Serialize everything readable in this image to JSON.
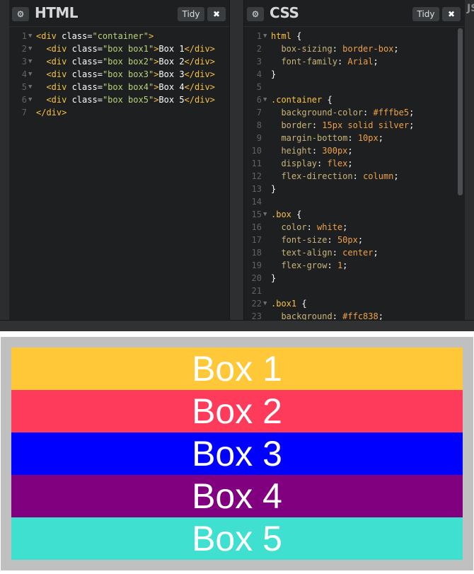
{
  "editor": {
    "html_panel": {
      "title": "HTML",
      "tidy_label": "Tidy",
      "close_label": "✖",
      "settings_icon": "gear-icon",
      "lines": [
        {
          "n": "1",
          "fold": true,
          "parts": [
            [
              "t-tag",
              "<div "
            ],
            [
              "t-attr",
              "class="
            ],
            [
              "t-str",
              "\"container\""
            ],
            [
              "t-tag",
              ">"
            ]
          ]
        },
        {
          "n": "2",
          "fold": true,
          "parts": [
            [
              "t-pun",
              "  "
            ],
            [
              "t-tag",
              "<div "
            ],
            [
              "t-attr",
              "class="
            ],
            [
              "t-str",
              "\"box box1\""
            ],
            [
              "t-tag",
              ">"
            ],
            [
              "t-txt",
              "Box 1"
            ],
            [
              "t-tag",
              "</div>"
            ]
          ]
        },
        {
          "n": "3",
          "fold": true,
          "parts": [
            [
              "t-pun",
              "  "
            ],
            [
              "t-tag",
              "<div "
            ],
            [
              "t-attr",
              "class="
            ],
            [
              "t-str",
              "\"box box2\""
            ],
            [
              "t-tag",
              ">"
            ],
            [
              "t-txt",
              "Box 2"
            ],
            [
              "t-tag",
              "</div>"
            ]
          ]
        },
        {
          "n": "4",
          "fold": true,
          "parts": [
            [
              "t-pun",
              "  "
            ],
            [
              "t-tag",
              "<div "
            ],
            [
              "t-attr",
              "class="
            ],
            [
              "t-str",
              "\"box box3\""
            ],
            [
              "t-tag",
              ">"
            ],
            [
              "t-txt",
              "Box 3"
            ],
            [
              "t-tag",
              "</div>"
            ]
          ]
        },
        {
          "n": "5",
          "fold": true,
          "parts": [
            [
              "t-pun",
              "  "
            ],
            [
              "t-tag",
              "<div "
            ],
            [
              "t-attr",
              "class="
            ],
            [
              "t-str",
              "\"box box4\""
            ],
            [
              "t-tag",
              ">"
            ],
            [
              "t-txt",
              "Box 4"
            ],
            [
              "t-tag",
              "</div>"
            ]
          ]
        },
        {
          "n": "6",
          "fold": true,
          "parts": [
            [
              "t-pun",
              "  "
            ],
            [
              "t-tag",
              "<div "
            ],
            [
              "t-attr",
              "class="
            ],
            [
              "t-str",
              "\"box box5\""
            ],
            [
              "t-tag",
              ">"
            ],
            [
              "t-txt",
              "Box 5"
            ],
            [
              "t-tag",
              "</div>"
            ]
          ]
        },
        {
          "n": "7",
          "fold": false,
          "parts": [
            [
              "t-tag",
              "</div>"
            ]
          ]
        }
      ]
    },
    "css_panel": {
      "title": "CSS",
      "tidy_label": "Tidy",
      "close_label": "✖",
      "settings_icon": "gear-icon",
      "lines": [
        {
          "n": "1",
          "fold": true,
          "parts": [
            [
              "t-sel",
              "html "
            ],
            [
              "t-pun",
              "{"
            ]
          ]
        },
        {
          "n": "2",
          "fold": false,
          "parts": [
            [
              "t-pun",
              "  "
            ],
            [
              "t-prop",
              "box-sizing"
            ],
            [
              "t-pun",
              ": "
            ],
            [
              "t-val",
              "border-box"
            ],
            [
              "t-pun",
              ";"
            ]
          ]
        },
        {
          "n": "3",
          "fold": false,
          "parts": [
            [
              "t-pun",
              "  "
            ],
            [
              "t-prop",
              "font-family"
            ],
            [
              "t-pun",
              ": "
            ],
            [
              "t-val",
              "Arial"
            ],
            [
              "t-pun",
              ";"
            ]
          ]
        },
        {
          "n": "4",
          "fold": false,
          "parts": [
            [
              "t-pun",
              "}"
            ]
          ]
        },
        {
          "n": "5",
          "fold": false,
          "parts": []
        },
        {
          "n": "6",
          "fold": true,
          "parts": [
            [
              "t-sel",
              ".container "
            ],
            [
              "t-pun",
              "{"
            ]
          ]
        },
        {
          "n": "7",
          "fold": false,
          "parts": [
            [
              "t-pun",
              "  "
            ],
            [
              "t-prop",
              "background-color"
            ],
            [
              "t-pun",
              ": "
            ],
            [
              "t-val",
              "#fffbe5"
            ],
            [
              "t-pun",
              ";"
            ]
          ]
        },
        {
          "n": "8",
          "fold": false,
          "parts": [
            [
              "t-pun",
              "  "
            ],
            [
              "t-prop",
              "border"
            ],
            [
              "t-pun",
              ": "
            ],
            [
              "t-num",
              "15px"
            ],
            [
              "t-val",
              " solid silver"
            ],
            [
              "t-pun",
              ";"
            ]
          ]
        },
        {
          "n": "9",
          "fold": false,
          "parts": [
            [
              "t-pun",
              "  "
            ],
            [
              "t-prop",
              "margin-bottom"
            ],
            [
              "t-pun",
              ": "
            ],
            [
              "t-num",
              "10px"
            ],
            [
              "t-pun",
              ";"
            ]
          ]
        },
        {
          "n": "10",
          "fold": false,
          "parts": [
            [
              "t-pun",
              "  "
            ],
            [
              "t-prop",
              "height"
            ],
            [
              "t-pun",
              ": "
            ],
            [
              "t-num",
              "300px"
            ],
            [
              "t-pun",
              ";"
            ]
          ]
        },
        {
          "n": "11",
          "fold": false,
          "parts": [
            [
              "t-pun",
              "  "
            ],
            [
              "t-prop",
              "display"
            ],
            [
              "t-pun",
              ": "
            ],
            [
              "t-val",
              "flex"
            ],
            [
              "t-pun",
              ";"
            ]
          ]
        },
        {
          "n": "12",
          "fold": false,
          "parts": [
            [
              "t-pun",
              "  "
            ],
            [
              "t-prop",
              "flex-direction"
            ],
            [
              "t-pun",
              ": "
            ],
            [
              "t-val",
              "column"
            ],
            [
              "t-pun",
              ";"
            ]
          ]
        },
        {
          "n": "13",
          "fold": false,
          "parts": [
            [
              "t-pun",
              "}"
            ]
          ]
        },
        {
          "n": "14",
          "fold": false,
          "parts": []
        },
        {
          "n": "15",
          "fold": true,
          "parts": [
            [
              "t-sel",
              ".box "
            ],
            [
              "t-pun",
              "{"
            ]
          ]
        },
        {
          "n": "16",
          "fold": false,
          "parts": [
            [
              "t-pun",
              "  "
            ],
            [
              "t-prop",
              "color"
            ],
            [
              "t-pun",
              ": "
            ],
            [
              "t-val",
              "white"
            ],
            [
              "t-pun",
              ";"
            ]
          ]
        },
        {
          "n": "17",
          "fold": false,
          "parts": [
            [
              "t-pun",
              "  "
            ],
            [
              "t-prop",
              "font-size"
            ],
            [
              "t-pun",
              ": "
            ],
            [
              "t-num",
              "50px"
            ],
            [
              "t-pun",
              ";"
            ]
          ]
        },
        {
          "n": "18",
          "fold": false,
          "parts": [
            [
              "t-pun",
              "  "
            ],
            [
              "t-prop",
              "text-align"
            ],
            [
              "t-pun",
              ": "
            ],
            [
              "t-val",
              "center"
            ],
            [
              "t-pun",
              ";"
            ]
          ]
        },
        {
          "n": "19",
          "fold": false,
          "parts": [
            [
              "t-pun",
              "  "
            ],
            [
              "t-prop",
              "flex-grow"
            ],
            [
              "t-pun",
              ": "
            ],
            [
              "t-num",
              "1"
            ],
            [
              "t-pun",
              ";"
            ]
          ]
        },
        {
          "n": "20",
          "fold": false,
          "parts": [
            [
              "t-pun",
              "}"
            ]
          ]
        },
        {
          "n": "21",
          "fold": false,
          "parts": []
        },
        {
          "n": "22",
          "fold": true,
          "parts": [
            [
              "t-sel",
              ".box1 "
            ],
            [
              "t-pun",
              "{"
            ]
          ]
        },
        {
          "n": "23",
          "fold": false,
          "parts": [
            [
              "t-pun",
              "  "
            ],
            [
              "t-prop",
              "background"
            ],
            [
              "t-pun",
              ": "
            ],
            [
              "t-val",
              "#ffc838"
            ],
            [
              "t-pun",
              ";"
            ]
          ]
        }
      ]
    },
    "edge_label": "JS"
  },
  "result": {
    "boxes": [
      {
        "label": "Box 1",
        "color": "#ffc838"
      },
      {
        "label": "Box 2",
        "color": "#ff3b5c"
      },
      {
        "label": "Box 3",
        "color": "#0000ff"
      },
      {
        "label": "Box 4",
        "color": "#800080"
      },
      {
        "label": "Box 5",
        "color": "#40e0d0"
      }
    ]
  }
}
